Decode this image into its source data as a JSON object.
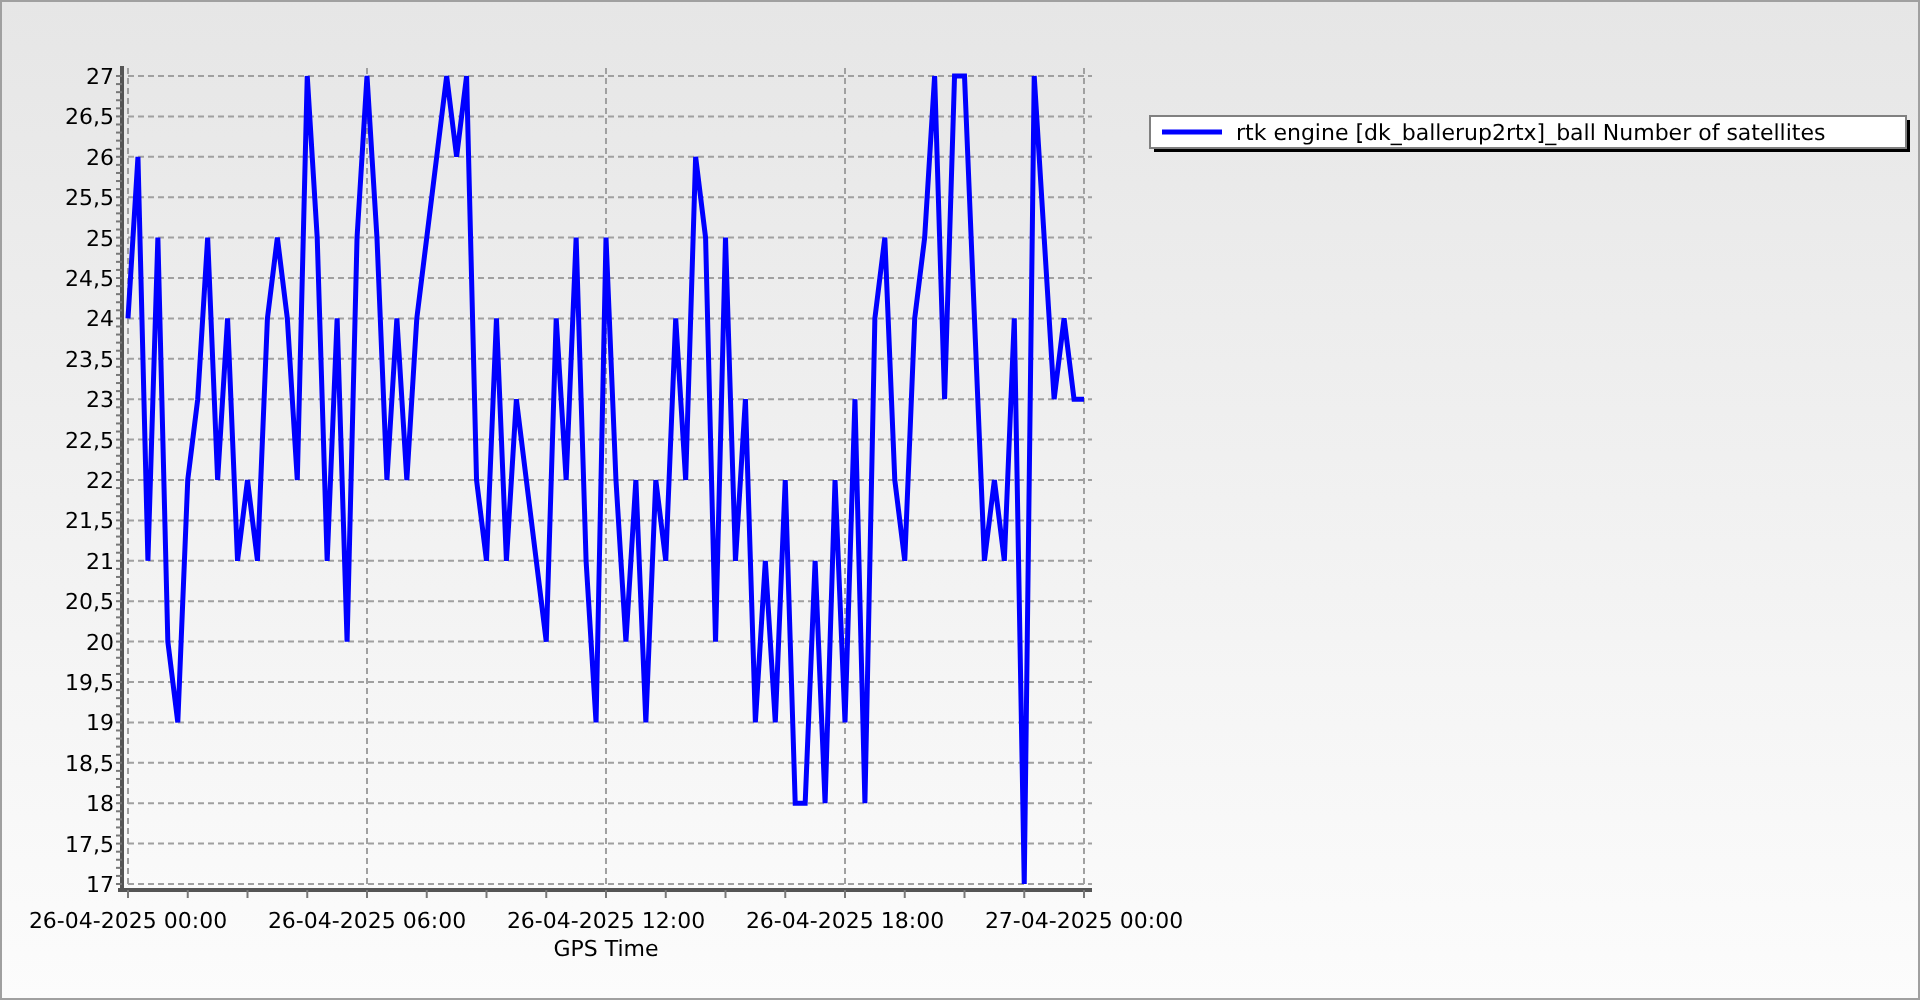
{
  "chart": {
    "chart_data": {
      "type": "line",
      "grid": true,
      "xlabel": "GPS Time",
      "ylim": [
        17,
        27
      ],
      "categories": [
        "26-04-2025 00:00",
        null,
        null,
        null,
        null,
        null,
        null,
        null,
        null,
        null,
        null,
        null,
        null,
        null,
        null,
        null,
        null,
        null,
        null,
        null,
        null,
        null,
        null,
        null,
        "26-04-2025 06:00",
        null,
        null,
        null,
        null,
        null,
        null,
        null,
        null,
        null,
        null,
        null,
        null,
        null,
        null,
        null,
        null,
        null,
        null,
        null,
        null,
        null,
        null,
        null,
        "26-04-2025 12:00",
        null,
        null,
        null,
        null,
        null,
        null,
        null,
        null,
        null,
        null,
        null,
        null,
        null,
        null,
        null,
        null,
        null,
        null,
        null,
        null,
        null,
        null,
        null,
        "26-04-2025 18:00",
        null,
        null,
        null,
        null,
        null,
        null,
        null,
        null,
        null,
        null,
        null,
        null,
        null,
        null,
        null,
        null,
        null,
        null,
        null,
        null,
        null,
        null,
        null,
        "27-04-2025 00:00"
      ],
      "yticks": [
        {
          "value": 17,
          "label": "17"
        },
        {
          "value": 17.5,
          "label": "17,5"
        },
        {
          "value": 18,
          "label": "18"
        },
        {
          "value": 18.5,
          "label": "18,5"
        },
        {
          "value": 19,
          "label": "19"
        },
        {
          "value": 19.5,
          "label": "19,5"
        },
        {
          "value": 20,
          "label": "20"
        },
        {
          "value": 20.5,
          "label": "20,5"
        },
        {
          "value": 21,
          "label": "21"
        },
        {
          "value": 21.5,
          "label": "21,5"
        },
        {
          "value": 22,
          "label": "22"
        },
        {
          "value": 22.5,
          "label": "22,5"
        },
        {
          "value": 23,
          "label": "23"
        },
        {
          "value": 23.5,
          "label": "23,5"
        },
        {
          "value": 24,
          "label": "24"
        },
        {
          "value": 24.5,
          "label": "24,5"
        },
        {
          "value": 25,
          "label": "25"
        },
        {
          "value": 25.5,
          "label": "25,5"
        },
        {
          "value": 26,
          "label": "26"
        },
        {
          "value": 26.5,
          "label": "26,5"
        },
        {
          "value": 27,
          "label": "27"
        }
      ],
      "series": [
        {
          "name": "rtk engine [dk_ballerup2rtx]_ball Number of satellites",
          "color": "#0000ff",
          "values": [
            24,
            26,
            21,
            25,
            20,
            19,
            22,
            23,
            25,
            22,
            24,
            21,
            22,
            21,
            24,
            25,
            24,
            22,
            27,
            25,
            21,
            24,
            20,
            25,
            27,
            25,
            22,
            24,
            22,
            24,
            25,
            26,
            27,
            26,
            27,
            22,
            21,
            24,
            21,
            23,
            22,
            21,
            20,
            24,
            22,
            25,
            21,
            19,
            25,
            22,
            20,
            22,
            19,
            22,
            21,
            24,
            22,
            26,
            25,
            20,
            25,
            21,
            23,
            19,
            21,
            19,
            22,
            18,
            18,
            21,
            18,
            22,
            19,
            23,
            18,
            24,
            25,
            22,
            21,
            24,
            25,
            27,
            23,
            27,
            27,
            24,
            21,
            22,
            21,
            24,
            17,
            27,
            25,
            23,
            24,
            23,
            23
          ]
        }
      ]
    }
  }
}
